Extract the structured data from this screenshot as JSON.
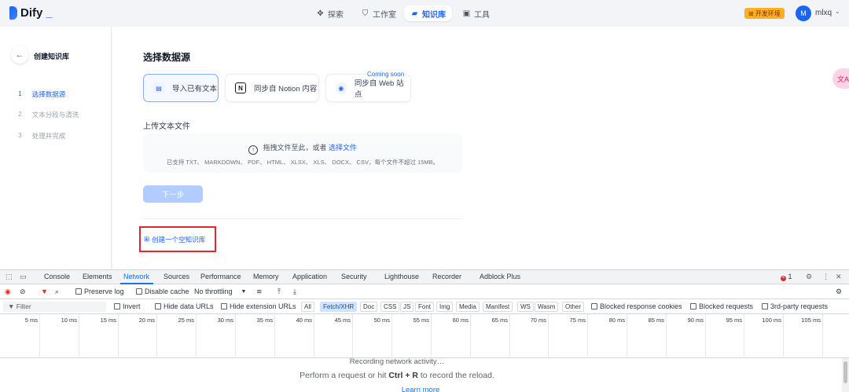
{
  "app": {
    "logo_text": "Dify",
    "nav": [
      {
        "label": "探索",
        "icon": "compass-icon"
      },
      {
        "label": "工作室",
        "icon": "studio-icon"
      },
      {
        "label": "知识库",
        "icon": "book-icon"
      },
      {
        "label": "工具",
        "icon": "toolbox-icon"
      }
    ],
    "env_badge": "开发环境",
    "user": {
      "initial": "M",
      "name": "mlxq"
    }
  },
  "sidebar": {
    "title": "创建知识库",
    "steps": [
      {
        "num": "1",
        "label": "选择数据源"
      },
      {
        "num": "2",
        "label": "文本分段与清洗"
      },
      {
        "num": "3",
        "label": "处理并完成"
      }
    ]
  },
  "main": {
    "section_title": "选择数据源",
    "sources": [
      {
        "label": "导入已有文本",
        "icon": "file-icon"
      },
      {
        "label": "同步自 Notion 内容",
        "icon": "notion-icon"
      },
      {
        "label": "同步自 Web 站点",
        "icon": "web-icon"
      }
    ],
    "coming_soon": "Coming soon",
    "upload_label": "上传文本文件",
    "dropzone_text": "拖拽文件至此，或者",
    "dropzone_link": "选择文件",
    "dropzone_hint": "已支持 TXT、 MARKDOWN、 PDF、 HTML、 XLSX、 XLS、 DOCX、 CSV，每个文件不超过 15MB。",
    "next_button": "下一步",
    "create_empty": "创建一个空知识库",
    "float_button": "文A"
  },
  "devtools": {
    "tabs": [
      "Console",
      "Elements",
      "Network",
      "Sources",
      "Performance",
      "Memory",
      "Application",
      "Security",
      "Lighthouse",
      "Recorder",
      "Adblock Plus"
    ],
    "active_tab": "Network",
    "error_count": "1",
    "toolbar": {
      "preserve_log": "Preserve log",
      "disable_cache": "Disable cache",
      "throttling": "No throttling"
    },
    "filter": {
      "placeholder": "Filter",
      "invert": "Invert",
      "hide_data_urls": "Hide data URLs",
      "hide_extension_urls": "Hide extension URLs",
      "types": [
        "All",
        "Fetch/XHR",
        "Doc",
        "CSS",
        "JS",
        "Font",
        "Img",
        "Media",
        "Manifest",
        "WS",
        "Wasm",
        "Other"
      ],
      "active_type": "Fetch/XHR",
      "blocked_response_cookies": "Blocked response cookies",
      "blocked_requests": "Blocked requests",
      "third_party": "3rd-party requests"
    },
    "timeline_ticks": [
      "5 ms",
      "10 ms",
      "15 ms",
      "20 ms",
      "25 ms",
      "30 ms",
      "35 ms",
      "40 ms",
      "45 ms",
      "50 ms",
      "55 ms",
      "60 ms",
      "65 ms",
      "70 ms",
      "75 ms",
      "80 ms",
      "85 ms",
      "90 ms",
      "95 ms",
      "100 ms",
      "105 ms"
    ],
    "recording": "Recording network activity…",
    "hint_prefix": "Perform a request or hit",
    "hint_keys": "Ctrl + R",
    "hint_suffix": "to record the reload.",
    "learn_more": "Learn more"
  }
}
